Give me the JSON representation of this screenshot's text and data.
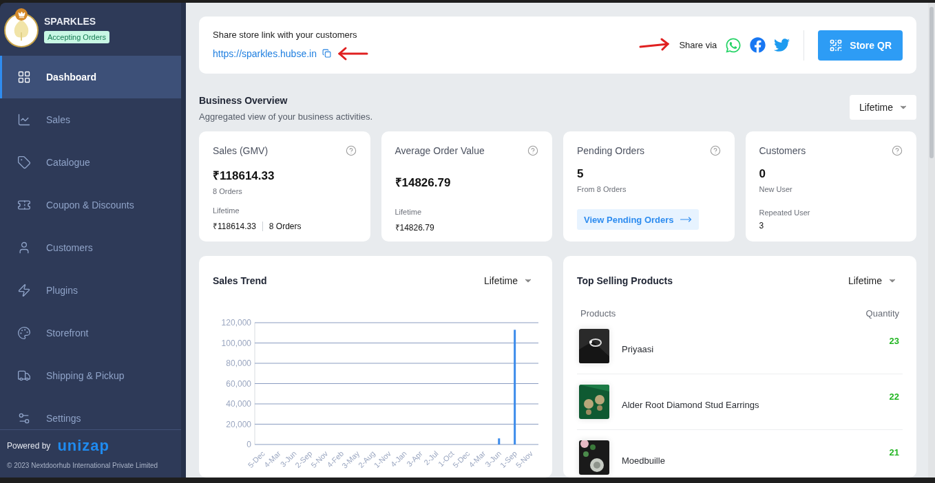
{
  "store": {
    "name": "SPARKLES",
    "status": "Accepting Orders"
  },
  "sidebar": {
    "items": [
      {
        "label": "Dashboard",
        "selected": true
      },
      {
        "label": "Sales",
        "selected": false
      },
      {
        "label": "Catalogue",
        "selected": false
      },
      {
        "label": "Coupon & Discounts",
        "selected": false
      },
      {
        "label": "Customers",
        "selected": false
      },
      {
        "label": "Plugins",
        "selected": false
      },
      {
        "label": "Storefront",
        "selected": false
      },
      {
        "label": "Shipping & Pickup",
        "selected": false
      },
      {
        "label": "Settings",
        "selected": false
      }
    ],
    "powered_by": "Powered by",
    "brand": "unizap",
    "copyright": "© 2023 Nextdoorhub International Private Limited"
  },
  "share": {
    "title": "Share store link with your customers",
    "link": "https://sparkles.hubse.in",
    "share_via": "Share via",
    "qr_button": "Store QR"
  },
  "overview": {
    "title": "Business Overview",
    "subtitle": "Aggregated view of your business activities.",
    "period": "Lifetime"
  },
  "stats": [
    {
      "kind": "sales",
      "title": "Sales (GMV)",
      "value": "₹118614.33",
      "note": "8 Orders",
      "footer_label": "Lifetime",
      "footer_value": "₹118614.33",
      "footer_extra": "8 Orders"
    },
    {
      "kind": "average",
      "title": "Average Order Value",
      "value": "₹14826.79",
      "footer_label": "Lifetime",
      "footer_value": "₹14826.79"
    },
    {
      "kind": "pending",
      "title": "Pending Orders",
      "value": "5",
      "note": "From 8 Orders",
      "action": "View Pending Orders"
    },
    {
      "kind": "customers",
      "title": "Customers",
      "value": "0",
      "note": "New User",
      "footer_label": "Repeated User",
      "footer_value": "3"
    }
  ],
  "sales_trend": {
    "title": "Sales Trend",
    "period": "Lifetime",
    "chart_data": {
      "type": "bar",
      "categories": [
        "5-Dec",
        "4-Mar",
        "3-Jun",
        "2-Sep",
        "5-Nov",
        "4-Feb",
        "3-May",
        "2-Aug",
        "1-Nov",
        "4-Jan",
        "3-Apr",
        "2-Jul",
        "1-Oct",
        "5-Dec",
        "4-Mar",
        "3-Jun",
        "1-Sep",
        "5-Nov"
      ],
      "grid": true,
      "series": [
        {
          "color": "#3b8beb",
          "values": [
            0,
            0,
            0,
            0,
            0,
            0,
            0,
            0,
            0,
            0,
            0,
            0,
            0,
            0,
            0,
            6000,
            113000,
            0
          ]
        }
      ],
      "ylim": [
        0,
        120000
      ],
      "yticks": [
        {
          "value": 0,
          "label": "0"
        },
        {
          "value": 20000,
          "label": "20,000"
        },
        {
          "value": 40000,
          "label": "40,000"
        },
        {
          "value": 60000,
          "label": "60,000"
        },
        {
          "value": 80000,
          "label": "80,000"
        },
        {
          "value": 100000,
          "label": "100,000"
        },
        {
          "value": 120000,
          "label": "120,000"
        }
      ]
    }
  },
  "top_products": {
    "title": "Top Selling Products",
    "period": "Lifetime",
    "columns": [
      "Products",
      "Quantity"
    ],
    "rows": [
      {
        "name": "Priyaasi",
        "quantity": "23"
      },
      {
        "name": "Alder Root Diamond Stud Earrings",
        "quantity": "22"
      },
      {
        "name": "Moedbuille",
        "quantity": "21"
      }
    ]
  }
}
